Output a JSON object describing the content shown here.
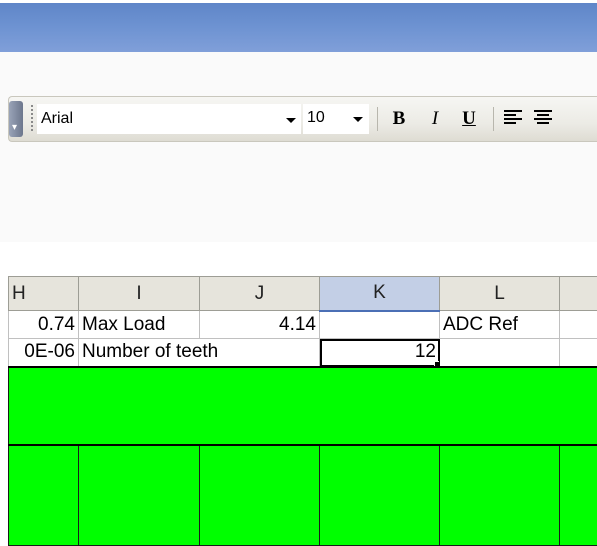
{
  "toolbar": {
    "font_name": "Arial",
    "font_size": "10",
    "bold_label": "B",
    "italic_label": "I",
    "underline_label": "U"
  },
  "grid": {
    "columns": [
      "H",
      "I",
      "J",
      "K",
      "L",
      ""
    ],
    "selected_column": "K",
    "rows": [
      [
        "0.74",
        "Max Load",
        "4.14",
        "",
        "ADC Ref",
        ""
      ],
      [
        "0E-06",
        "Number of teeth",
        "",
        "12",
        "",
        ""
      ]
    ],
    "active_cell": "K",
    "fill_color": "#00ff00"
  }
}
